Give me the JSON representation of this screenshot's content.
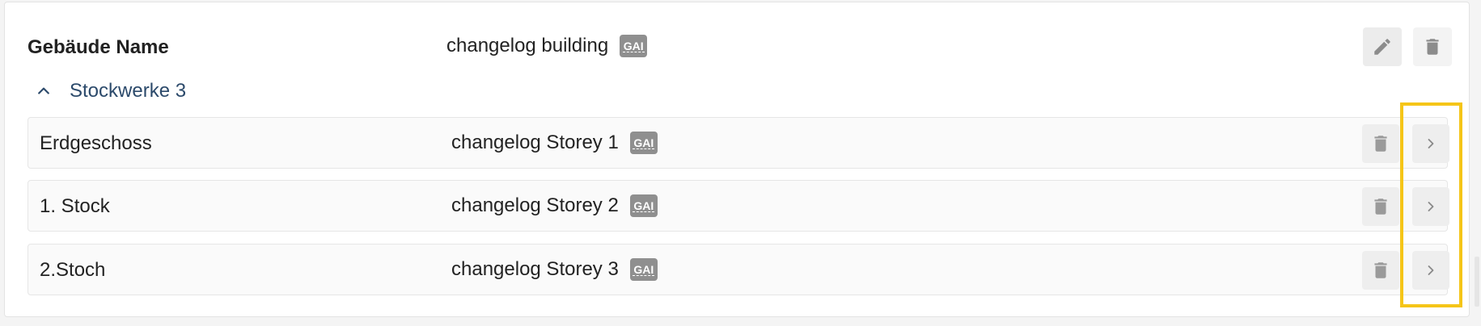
{
  "building": {
    "label": "Gebäude Name",
    "value": "changelog building",
    "badge": "GAI",
    "edit_icon": "pencil-icon",
    "delete_icon": "trash-icon"
  },
  "storeys": {
    "toggle_icon": "chevron-up-icon",
    "label": "Stockwerke 3",
    "items": [
      {
        "name": "Erdgeschoss",
        "value": "changelog Storey 1",
        "badge": "GAI"
      },
      {
        "name": "1. Stock",
        "value": "changelog Storey 2",
        "badge": "GAI"
      },
      {
        "name": "2.Stoch",
        "value": "changelog Storey 3",
        "badge": "GAI"
      }
    ],
    "row_delete_icon": "trash-icon",
    "row_next_icon": "chevron-right-icon"
  },
  "colors": {
    "highlight": "#f5c518",
    "link_text": "#2c4a6b",
    "badge_bg": "#8f8f8f"
  }
}
